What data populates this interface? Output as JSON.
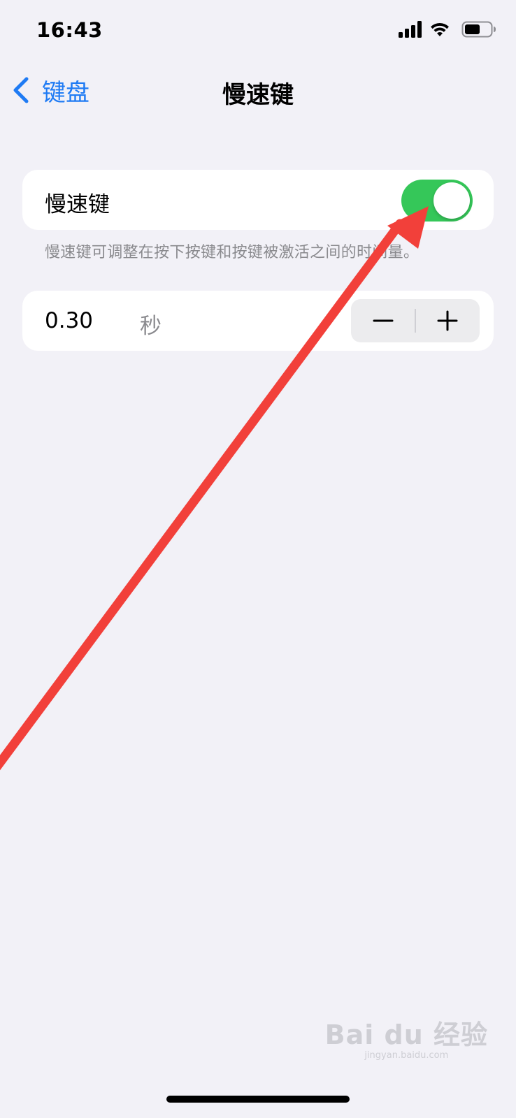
{
  "status_bar": {
    "time": "16:43",
    "icons": [
      "cellular-signal-icon",
      "wifi-icon",
      "battery-icon"
    ]
  },
  "nav": {
    "back_label": "键盘",
    "title": "慢速键",
    "back_icon": "chevron-left-icon"
  },
  "slow_keys": {
    "label": "慢速键",
    "enabled": true,
    "toggle_color": "#35c759",
    "footnote": "慢速键可调整在按下按键和按键被激活之间的时间量。"
  },
  "delay": {
    "value": "0.30",
    "unit": "秒",
    "minus_icon": "minus-icon",
    "plus_icon": "plus-icon"
  },
  "colors": {
    "background": "#f2f1f7",
    "accent": "#1f7bf4",
    "annotation_arrow": "#f2403a"
  },
  "watermark": {
    "logo": "Bai du 经验",
    "sub": "jingyan.baidu.com"
  }
}
